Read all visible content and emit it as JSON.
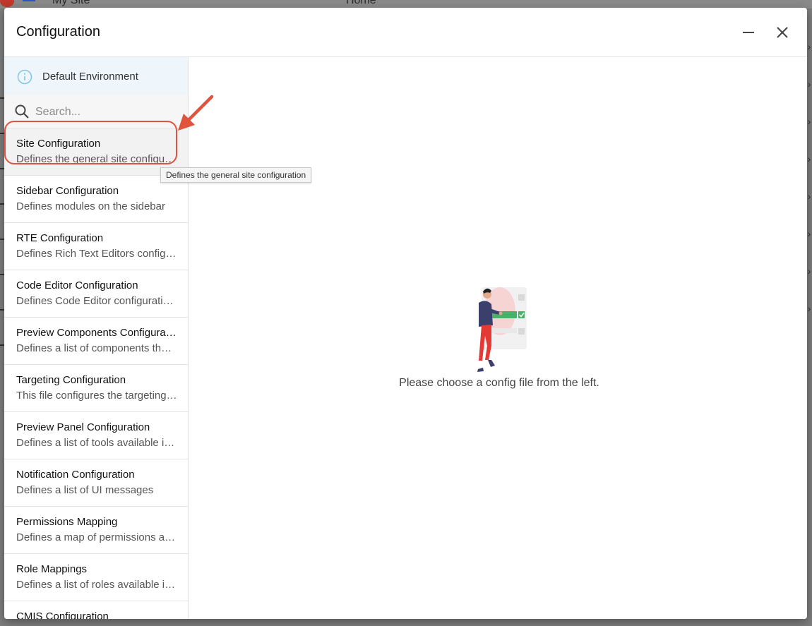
{
  "backdrop": {
    "site_name": "My Site",
    "home_label": "Home"
  },
  "dialog": {
    "title": "Configuration",
    "minimize_icon": "minimize-icon",
    "close_icon": "close-icon"
  },
  "environment": {
    "icon": "info-icon",
    "label": "Default Environment"
  },
  "search": {
    "icon": "search-icon",
    "placeholder": "Search...",
    "value": ""
  },
  "config_items": [
    {
      "title": "Site Configuration",
      "description": "Defines the general site configuration"
    },
    {
      "title": "Sidebar Configuration",
      "description": "Defines modules on the sidebar"
    },
    {
      "title": "RTE Configuration",
      "description": "Defines Rich Text Editors configurations"
    },
    {
      "title": "Code Editor Configuration",
      "description": "Defines Code Editor configurations"
    },
    {
      "title": "Preview Components Configuration",
      "description": "Defines a list of components that can be dragged"
    },
    {
      "title": "Targeting Configuration",
      "description": "This file configures the targeting system"
    },
    {
      "title": "Preview Panel Configuration",
      "description": "Defines a list of tools available in the preview panel"
    },
    {
      "title": "Notification Configuration",
      "description": "Defines a list of UI messages"
    },
    {
      "title": "Permissions Mapping",
      "description": "Defines a map of permissions and paths"
    },
    {
      "title": "Role Mappings",
      "description": "Defines a list of roles available in the site"
    },
    {
      "title": "CMIS Configuration",
      "description": ""
    }
  ],
  "tooltip": {
    "text": "Defines the general site configuration"
  },
  "empty_state": {
    "message": "Please choose a config file from the left."
  },
  "colors": {
    "annotation": "#e0533c",
    "info_icon": "#7fc6e6",
    "banner_bg": "#eef6fb",
    "illustration_green": "#4caf6a",
    "illustration_red": "#e53935"
  }
}
